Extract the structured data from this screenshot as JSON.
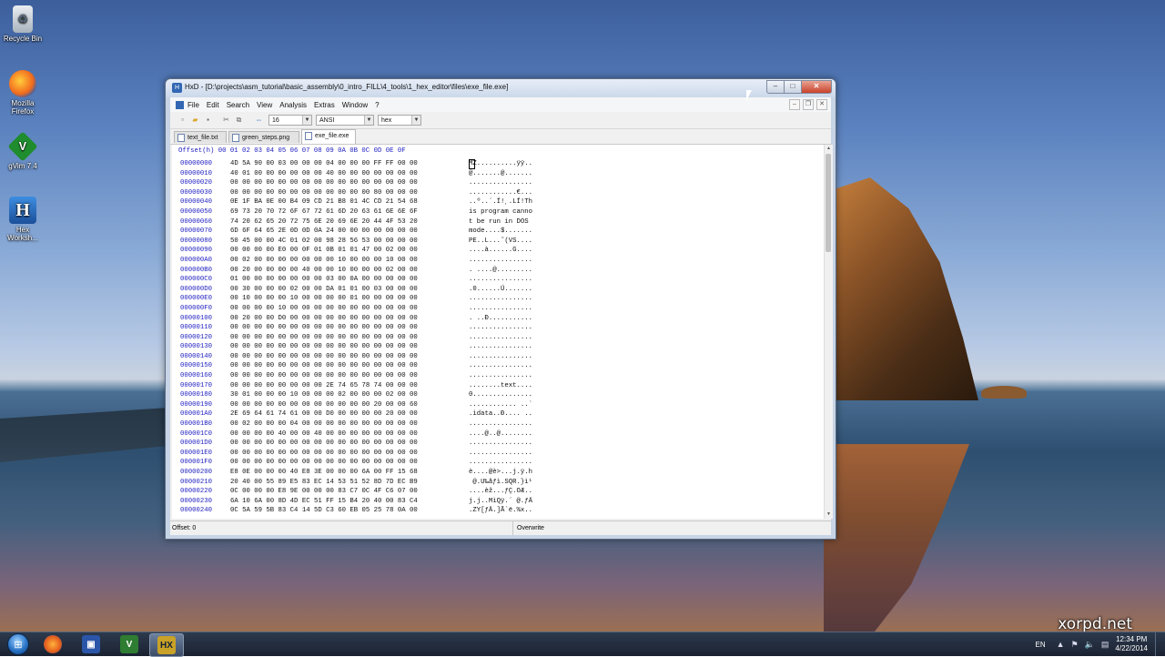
{
  "desktop": {
    "icons": [
      {
        "label": "Recycle Bin"
      },
      {
        "label": "Mozilla Firefox"
      },
      {
        "label": "gVim 7.4"
      },
      {
        "label": "Hex Worksh..."
      }
    ],
    "watermark": "xorpd.net"
  },
  "window": {
    "title": "HxD - [D:\\projects\\asm_tutorial\\basic_assembly\\0_intro_FILL\\4_tools\\1_hex_editor\\files\\exe_file.exe]",
    "menu": [
      "File",
      "Edit",
      "Search",
      "View",
      "Analysis",
      "Extras",
      "Window",
      "?"
    ],
    "toolbar": {
      "bytes_per_row": "16",
      "charset": "ANSI",
      "offset_base": "hex"
    },
    "tabs": [
      {
        "label": "text_file.txt",
        "active": false
      },
      {
        "label": "green_steps.png",
        "active": false
      },
      {
        "label": "exe_file.exe",
        "active": true
      }
    ],
    "hex_header": "Offset(h) 00 01 02 03 04 05 06 07 08 09 0A 0B 0C 0D 0E 0F",
    "rows": [
      {
        "o": "00000000",
        "h": "4D 5A 90 00 03 00 00 00 04 00 00 00 FF FF 00 00",
        "t": "MZ..........ÿÿ.."
      },
      {
        "o": "00000010",
        "h": "40 01 00 00 00 00 00 00 40 00 00 00 00 00 00 00",
        "t": "@.......@......."
      },
      {
        "o": "00000020",
        "h": "00 00 00 00 00 00 00 00 00 00 00 00 00 00 00 00",
        "t": "................"
      },
      {
        "o": "00000030",
        "h": "00 00 00 00 00 00 00 00 00 00 00 00 80 00 00 00",
        "t": "............€..."
      },
      {
        "o": "00000040",
        "h": "0E 1F BA 0E 00 B4 09 CD 21 B8 01 4C CD 21 54 68",
        "t": "..º..´.Í!¸.LÍ!Th"
      },
      {
        "o": "00000050",
        "h": "69 73 20 70 72 6F 67 72 61 6D 20 63 61 6E 6E 6F",
        "t": "is program canno"
      },
      {
        "o": "00000060",
        "h": "74 20 62 65 20 72 75 6E 20 69 6E 20 44 4F 53 20",
        "t": "t be run in DOS "
      },
      {
        "o": "00000070",
        "h": "6D 6F 64 65 2E 0D 0D 0A 24 00 00 00 00 00 00 00",
        "t": "mode....$......."
      },
      {
        "o": "00000080",
        "h": "50 45 00 00 4C 01 02 00 98 28 56 53 00 00 00 00",
        "t": "PE..L...˜(VS...."
      },
      {
        "o": "00000090",
        "h": "00 00 00 00 E0 00 0F 01 0B 01 01 47 00 02 00 00",
        "t": "....à......G...."
      },
      {
        "o": "000000A0",
        "h": "00 02 00 00 00 00 00 00 00 10 00 00 00 10 00 00",
        "t": "................"
      },
      {
        "o": "000000B0",
        "h": "00 20 00 00 00 00 40 00 00 10 00 00 00 02 00 00",
        "t": ". ....@........."
      },
      {
        "o": "000000C0",
        "h": "01 00 00 00 00 00 00 00 03 00 0A 00 00 00 00 00",
        "t": "................"
      },
      {
        "o": "000000D0",
        "h": "00 30 00 00 00 02 00 00 DA 01 01 00 03 00 00 00",
        "t": ".0......Ú......."
      },
      {
        "o": "000000E0",
        "h": "00 10 00 00 00 10 00 00 00 00 01 00 00 00 00 00",
        "t": "................"
      },
      {
        "o": "000000F0",
        "h": "00 00 00 00 10 00 00 00 00 00 00 00 00 00 00 00",
        "t": "................"
      },
      {
        "o": "00000100",
        "h": "00 20 00 00 D0 00 00 00 00 00 00 00 00 00 00 00",
        "t": ". ..Ð..........."
      },
      {
        "o": "00000110",
        "h": "00 00 00 00 00 00 00 00 00 00 00 00 00 00 00 00",
        "t": "................"
      },
      {
        "o": "00000120",
        "h": "00 00 00 00 00 00 00 00 00 00 00 00 00 00 00 00",
        "t": "................"
      },
      {
        "o": "00000130",
        "h": "00 00 00 00 00 00 00 00 00 00 00 00 00 00 00 00",
        "t": "................"
      },
      {
        "o": "00000140",
        "h": "00 00 00 00 00 00 00 00 00 00 00 00 00 00 00 00",
        "t": "................"
      },
      {
        "o": "00000150",
        "h": "00 00 00 00 00 00 00 00 00 00 00 00 00 00 00 00",
        "t": "................"
      },
      {
        "o": "00000160",
        "h": "00 00 00 00 00 00 00 00 00 00 00 00 00 00 00 00",
        "t": "................"
      },
      {
        "o": "00000170",
        "h": "00 00 00 00 00 00 00 00 2E 74 65 78 74 00 00 00",
        "t": "........text...."
      },
      {
        "o": "00000180",
        "h": "30 01 00 00 00 10 00 00 00 02 00 00 00 02 00 00",
        "t": "0..............."
      },
      {
        "o": "00000190",
        "h": "00 00 00 00 00 00 00 00 00 00 00 00 20 00 00 60",
        "t": "............ ..`"
      },
      {
        "o": "000001A0",
        "h": "2E 69 64 61 74 61 00 00 D0 00 00 00 00 20 00 00",
        "t": ".idata..Ð.... .."
      },
      {
        "o": "000001B0",
        "h": "00 02 00 00 00 04 00 00 00 00 00 00 00 00 00 00",
        "t": "................"
      },
      {
        "o": "000001C0",
        "h": "00 00 00 00 40 00 00 40 00 00 00 00 00 00 00 00",
        "t": "....@..@........"
      },
      {
        "o": "000001D0",
        "h": "00 00 00 00 00 00 00 00 00 00 00 00 00 00 00 00",
        "t": "................"
      },
      {
        "o": "000001E0",
        "h": "00 00 00 00 00 00 00 00 00 00 00 00 00 00 00 00",
        "t": "................"
      },
      {
        "o": "000001F0",
        "h": "00 00 00 00 00 00 00 00 00 00 00 00 00 00 00 00",
        "t": "................"
      },
      {
        "o": "00000200",
        "h": "E8 0E 00 00 00 40 E8 3E 00 00 00 6A 00 FF 15 68",
        "t": "è....@è>...j.ÿ.h"
      },
      {
        "o": "00000210",
        "h": "20 40 00 55 89 E5 83 EC 14 53 51 52 8D 7D EC B9",
        "t": " @.U‰åƒì.SQR.}ì¹"
      },
      {
        "o": "00000220",
        "h": "0C 00 00 00 E8 9E 00 00 00 83 C7 0C 4F C6 07 00",
        "t": "....èž...ƒÇ.OÆ.."
      },
      {
        "o": "00000230",
        "h": "6A 10 6A 00 8D 4D EC 51 FF 15 B4 20 40 00 83 C4",
        "t": "j.j..MìQÿ.´ @.ƒÄ"
      },
      {
        "o": "00000240",
        "h": "0C 5A 59 5B 83 C4 14 5D C3 60 EB 05 25 78 0A 00",
        "t": ".ZY[ƒÄ.]Ã`ë.%x.."
      }
    ],
    "status": {
      "offset": "Offset: 0",
      "mode": "Overwrite"
    }
  },
  "taskbar": {
    "language": "EN",
    "time": "12:34 PM",
    "date": "4/22/2014"
  }
}
